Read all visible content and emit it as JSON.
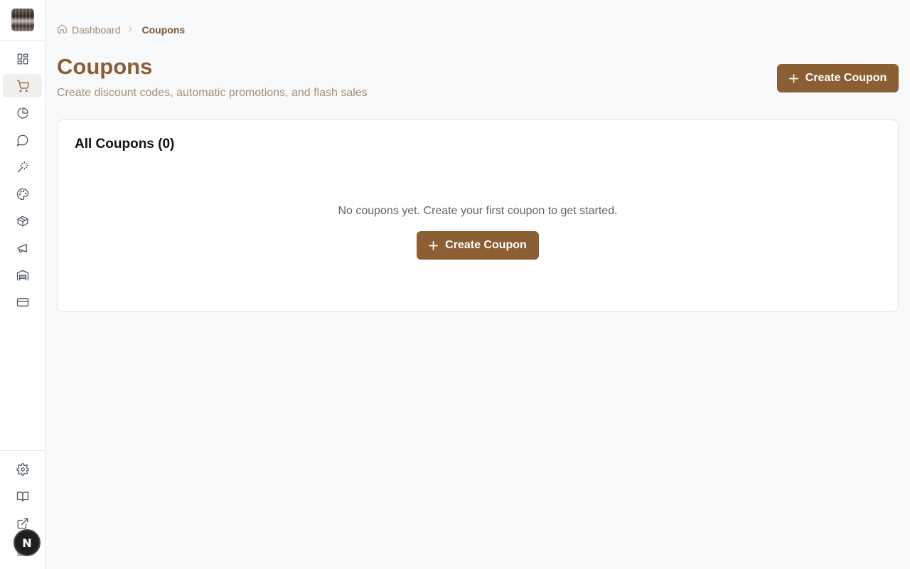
{
  "sidebar": {
    "logo": "store-logo",
    "items": [
      {
        "icon": "dashboard-icon",
        "active": false
      },
      {
        "icon": "shopping-cart-icon",
        "active": true
      },
      {
        "icon": "pie-chart-icon",
        "active": false
      },
      {
        "icon": "message-icon",
        "active": false
      },
      {
        "icon": "magic-wand-icon",
        "active": false
      },
      {
        "icon": "palette-icon",
        "active": false
      },
      {
        "icon": "package-icon",
        "active": false
      },
      {
        "icon": "megaphone-icon",
        "active": false
      },
      {
        "icon": "warehouse-icon",
        "active": false
      },
      {
        "icon": "credit-card-icon",
        "active": false
      }
    ],
    "bottom_items": [
      {
        "icon": "gear-icon"
      },
      {
        "icon": "book-icon"
      },
      {
        "icon": "external-link-icon"
      },
      {
        "icon": "logout-icon"
      }
    ],
    "avatar_letter": "N"
  },
  "breadcrumb": {
    "home_label": "Dashboard",
    "current": "Coupons"
  },
  "header": {
    "title": "Coupons",
    "subtitle": "Create discount codes, automatic promotions, and flash sales",
    "create_button": "Create Coupon"
  },
  "card": {
    "title": "All Coupons (0)",
    "empty_message": "No coupons yet. Create your first coupon to get started.",
    "create_button": "Create Coupon"
  },
  "colors": {
    "accent": "#8b5e34",
    "background": "#f8f9fb"
  }
}
